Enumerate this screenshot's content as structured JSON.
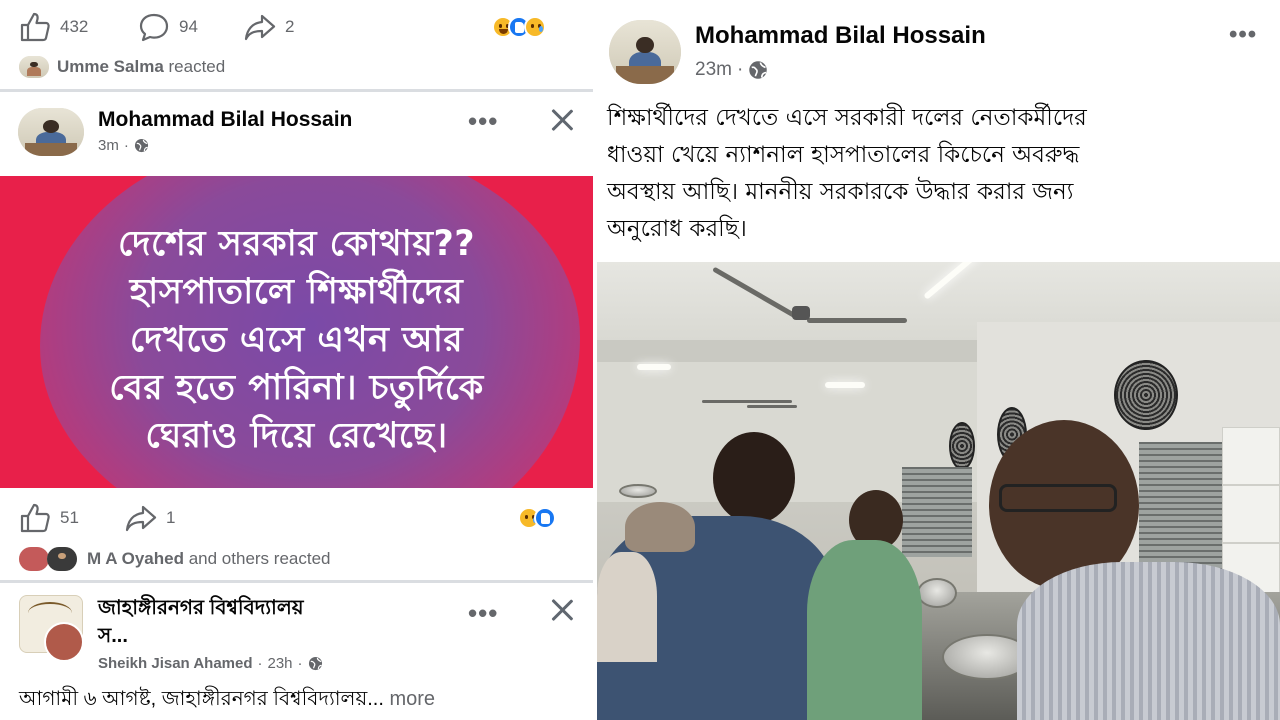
{
  "left_panel": {
    "top_stats": {
      "likes": "432",
      "comments": "94",
      "shares": "2",
      "reactions": [
        "haha",
        "like",
        "sad"
      ],
      "reactor_name": "Umme Salma",
      "reacted_text": "reacted"
    },
    "post": {
      "author": "Mohammad Bilal Hossain",
      "time": "3m",
      "visibility_icon": "globe-icon",
      "banner_lines": [
        "দেশের সরকার কোথায়??",
        "হাসপাতালে শিক্ষার্থীদের",
        "দেখতে এসে এখন আর",
        "বের হতে পারিনা। চতুর্দিকে",
        "ঘেরাও  দিয়ে রেখেছে।"
      ],
      "banner_colors": {
        "background": "#e8204a",
        "blob": "#7a4aa8",
        "text": "#ffffff"
      },
      "likes": "51",
      "shares": "1",
      "reactions": [
        "sad",
        "like"
      ],
      "reactor_name": "M A Oyahed",
      "reacted_text": "and others reacted"
    },
    "next_post": {
      "group_name_line1": "জাহাঙ্গীরনগর বিশ্ববিদ্যালয়",
      "group_name_line2": "স...",
      "author": "Sheikh Jisan Ahamed",
      "time": "23h",
      "excerpt": "আগামী ৬ আগষ্ট, জাহাঙ্গীরনগর বিশ্ববিদ্যালয়...",
      "more_label": "more"
    }
  },
  "right_panel": {
    "author": "Mohammad Bilal Hossain",
    "time": "23m",
    "visibility_icon": "globe-icon",
    "text_lines": [
      "শিক্ষার্থীদের দেখতে এসে সরকারী দলের নেতাকর্মীদের",
      "ধাওয়া খেয়ে ন্যাশনাল হাসপাতালের কিচেনে অবরুদ্ধ",
      "অবস্থায় আছি। মাননীয় সরকারকে উদ্ধার করার জন্য",
      "অনুরোধ করছি।"
    ]
  },
  "colors": {
    "text_primary": "#050505",
    "text_secondary": "#65676b",
    "like_blue": "#1877f2",
    "divider": "#dadde1"
  }
}
